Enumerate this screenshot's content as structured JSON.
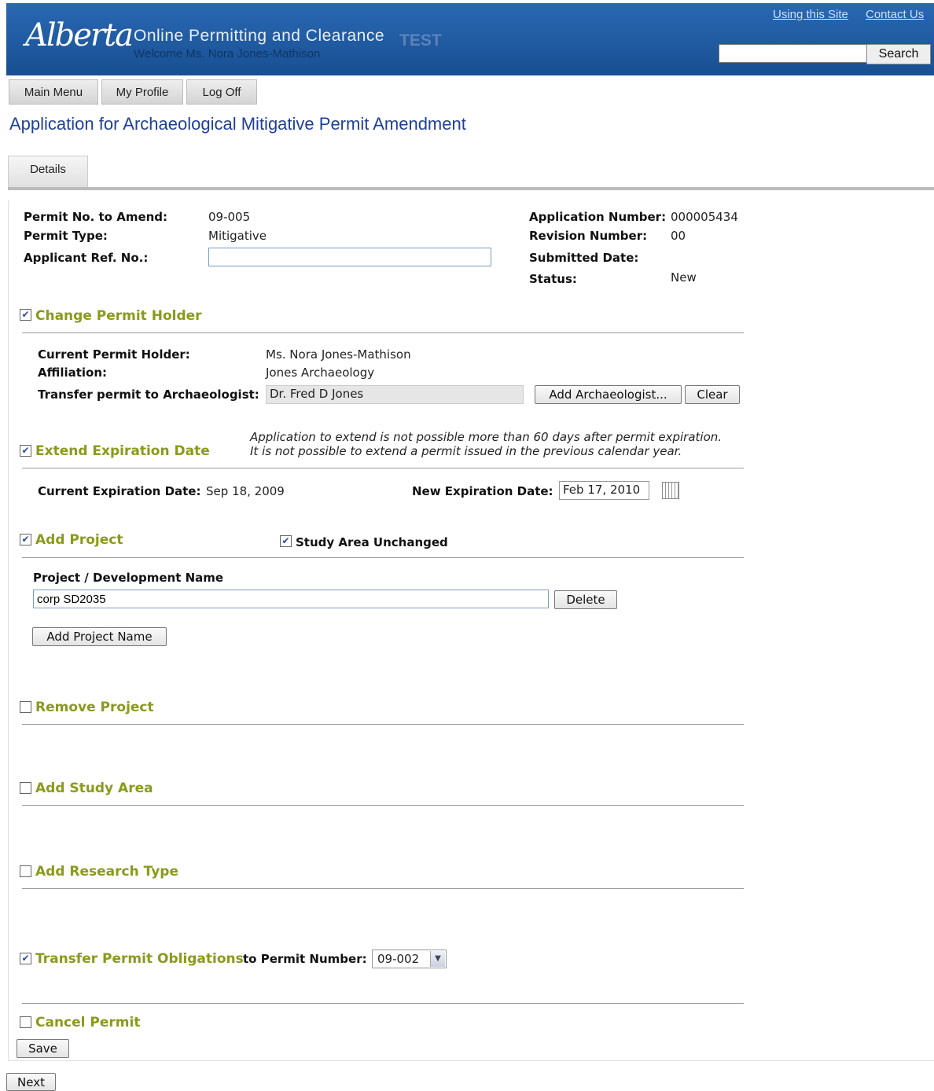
{
  "header": {
    "logo": "Alberta",
    "app_title": "Online Permitting and Clearance",
    "environment": "TEST",
    "welcome": "Welcome Ms. Nora Jones-Mathison",
    "links": {
      "using_site": "Using this Site",
      "contact": "Contact Us"
    },
    "search": {
      "value": "",
      "button": "Search"
    }
  },
  "nav": {
    "main_menu": "Main Menu",
    "my_profile": "My Profile",
    "log_off": "Log Off"
  },
  "page_title": "Application for Archaeological Mitigative Permit Amendment",
  "tabs": {
    "details": "Details"
  },
  "info": {
    "permit_no_label": "Permit No. to Amend:",
    "permit_no": "09-005",
    "permit_type_label": "Permit Type:",
    "permit_type": "Mitigative",
    "applicant_ref_label": "Applicant Ref. No.:",
    "applicant_ref": "",
    "app_number_label": "Application Number:",
    "app_number": "000005434",
    "revision_label": "Revision Number:",
    "revision": "00",
    "submitted_label": "Submitted Date:",
    "submitted": "",
    "status_label": "Status:",
    "status": "New"
  },
  "change_holder": {
    "title": "Change Permit Holder",
    "checked": true,
    "current_label": "Current Permit Holder:",
    "current": "Ms. Nora Jones-Mathison",
    "affiliation_label": "Affiliation:",
    "affiliation": "Jones Archaeology",
    "transfer_label": "Transfer permit to Archaeologist:",
    "transfer": "Dr. Fred D Jones",
    "add_button": "Add Archaeologist...",
    "clear_button": "Clear"
  },
  "extend": {
    "title": "Extend Expiration Date",
    "checked": true,
    "note1": "Application to extend is not possible more than 60 days after permit expiration.",
    "note2": "It is not possible to extend a permit issued in the previous calendar year.",
    "current_label": "Current Expiration Date:",
    "current": "Sep 18, 2009",
    "new_label": "New Expiration Date:",
    "new": "Feb 17, 2010"
  },
  "add_project": {
    "title": "Add Project",
    "checked": true,
    "study_area_label": "Study Area Unchanged",
    "study_area_checked": true,
    "name_label": "Project / Development Name",
    "name": "corp SD2035",
    "delete_button": "Delete",
    "add_button": "Add Project Name"
  },
  "remove_project": {
    "title": "Remove Project",
    "checked": false
  },
  "add_study_area": {
    "title": "Add Study Area",
    "checked": false
  },
  "add_research": {
    "title": "Add Research Type",
    "checked": false
  },
  "transfer_obligations": {
    "title": "Transfer Permit Obligations",
    "checked": true,
    "to_label": "to Permit Number:",
    "selected": "09-002"
  },
  "cancel_permit": {
    "title": "Cancel Permit",
    "checked": false
  },
  "buttons": {
    "save": "Save",
    "next": "Next"
  }
}
